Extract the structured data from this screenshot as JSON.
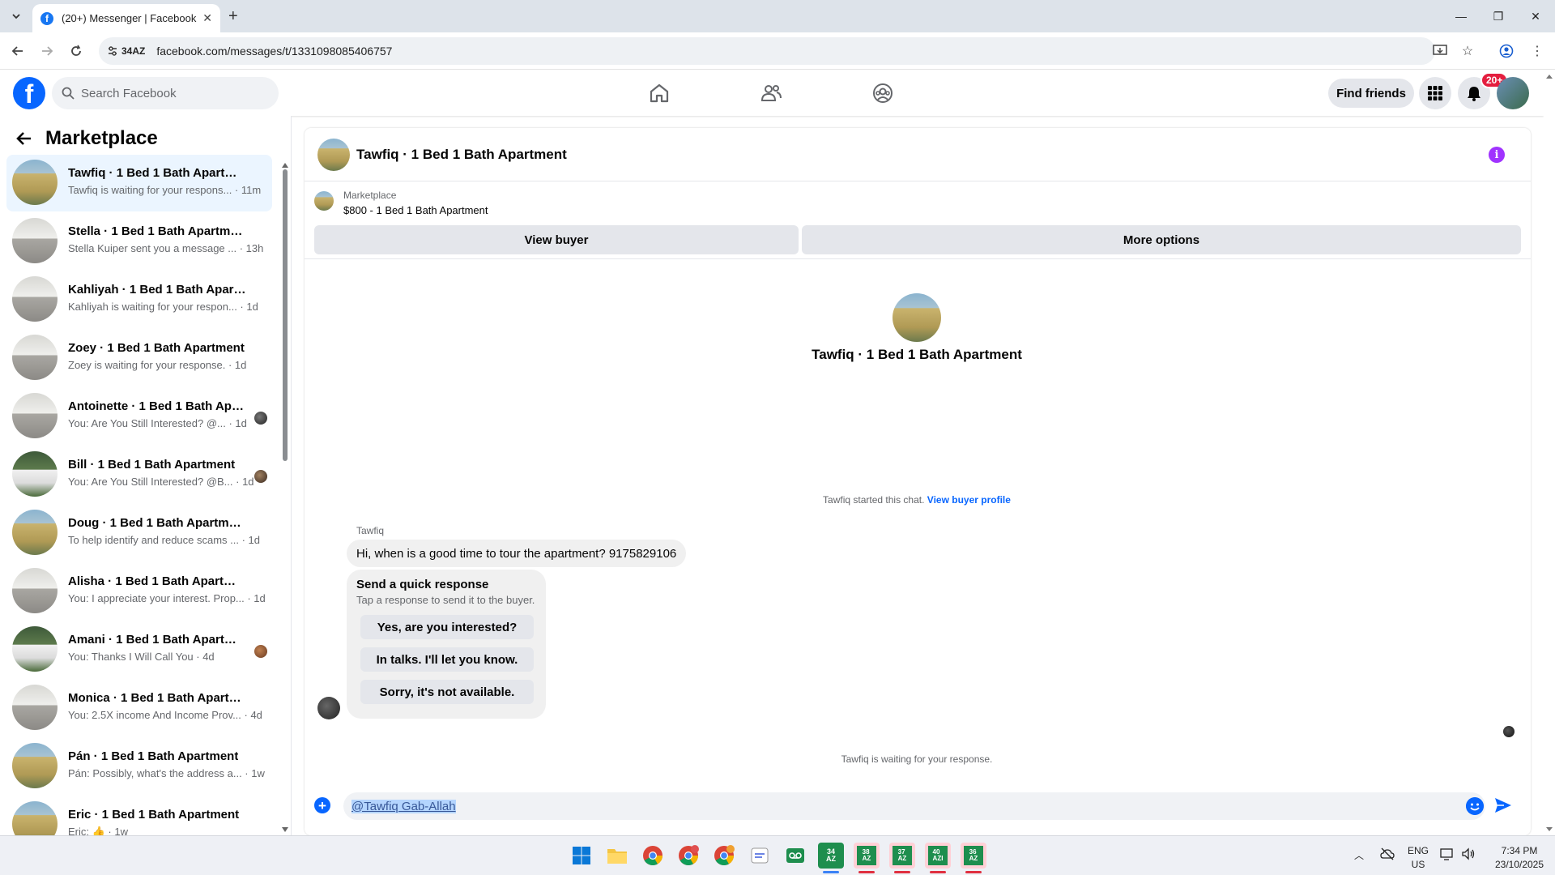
{
  "browser": {
    "tab_title": "(20+) Messenger | Facebook",
    "site_chip": "34AZ",
    "url": "facebook.com/messages/t/1331098085406757"
  },
  "fb": {
    "search_placeholder": "Search Facebook",
    "find_friends": "Find friends",
    "notif_badge": "20+"
  },
  "sidebar": {
    "title": "Marketplace",
    "conversations": [
      {
        "name": "Tawfiq · 1 Bed 1 Bath Apartment",
        "preview": "Tawfiq is waiting for your respons... · 11m",
        "active": true,
        "read": false
      },
      {
        "name": "Stella · 1 Bed 1 Bath Apartment",
        "preview": "Stella Kuiper sent you a message ... · 13h",
        "active": false,
        "read": false
      },
      {
        "name": "Kahliyah · 1 Bed 1 Bath Apartment",
        "preview": "Kahliyah is waiting for your respon... · 1d",
        "active": false,
        "read": false
      },
      {
        "name": "Zoey · 1 Bed 1 Bath Apartment",
        "preview": "Zoey is waiting for your response. · 1d",
        "active": false,
        "read": false
      },
      {
        "name": "Antoinette · 1 Bed 1 Bath Apar...",
        "preview": "You: Are You Still Interested? @... · 1d",
        "active": false,
        "read": true
      },
      {
        "name": "Bill · 1 Bed 1 Bath Apartment",
        "preview": "You: Are You Still Interested? @B... · 1d",
        "active": false,
        "read": true
      },
      {
        "name": "Doug · 1 Bed 1 Bath Apartment",
        "preview": "To help identify and reduce scams ... · 1d",
        "active": false,
        "read": false
      },
      {
        "name": "Alisha · 1 Bed 1 Bath Apartment",
        "preview": "You: I appreciate your interest. Prop... · 1d",
        "active": false,
        "read": false
      },
      {
        "name": "Amani · 1 Bed 1 Bath Apartment",
        "preview": "You: Thanks I Will Call You · 4d",
        "active": false,
        "read": true
      },
      {
        "name": "Monica · 1 Bed 1 Bath Apartment",
        "preview": "You: 2.5X income And Income Prov... · 4d",
        "active": false,
        "read": false
      },
      {
        "name": "Pán · 1 Bed 1 Bath Apartment",
        "preview": "Pán: Possibly, what's the address a... · 1w",
        "active": false,
        "read": false
      },
      {
        "name": "Eric · 1 Bed 1 Bath Apartment",
        "preview": "Eric: 👍 · 1w",
        "active": false,
        "read": false
      }
    ]
  },
  "chat": {
    "header_name": "Tawfiq · 1 Bed 1 Bath Apartment",
    "marketplace_label": "Marketplace",
    "listing": "$800 - 1 Bed 1 Bath Apartment",
    "view_buyer": "View buyer",
    "more_options": "More options",
    "profile_name": "Tawfiq · 1 Bed 1 Bath Apartment",
    "started_text": "Tawfiq started this chat.",
    "view_buyer_profile": "View buyer profile",
    "sender": "Tawfiq",
    "message": "Hi, when is a good time to tour the apartment? 9175829106",
    "quick_title": "Send a quick response",
    "quick_sub": "Tap a response to send it to the buyer.",
    "quick_options": [
      "Yes, are you interested?",
      "In talks. I'll let you know.",
      "Sorry, it's not available."
    ],
    "waiting": "Tawfiq is waiting for your response.",
    "composer_value": "@Tawfiq Gab-Allah"
  },
  "taskbar": {
    "apps": [
      "34 AZ",
      "38 AZ",
      "37 AZ",
      "40 AZI",
      "36 AZ"
    ],
    "lang_line1": "ENG",
    "lang_line2": "US",
    "time": "7:34 PM",
    "date": "23/10/2025"
  },
  "colors": {
    "fb_blue": "#0866ff",
    "active_conv": "#ebf5ff",
    "info_purple": "#a033ff"
  }
}
